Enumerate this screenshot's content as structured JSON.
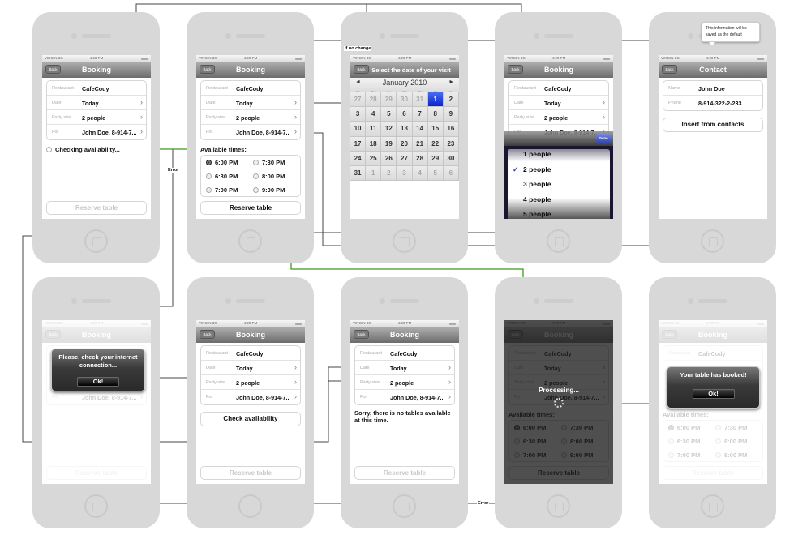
{
  "status": {
    "carrier": "VIRGIN  3G",
    "time": "4:20 PM"
  },
  "common": {
    "back": "Back",
    "chevron": "›"
  },
  "booking_rows": [
    {
      "label": "Restaurant",
      "value": "CafeCody",
      "chevron": false
    },
    {
      "label": "Date",
      "value": "Today",
      "chevron": true
    },
    {
      "label": "Party size",
      "value": "2 people",
      "chevron": true
    },
    {
      "label": "For",
      "value": "John Doe, 8-914-7...",
      "chevron": true
    }
  ],
  "times": {
    "label": "Available times:",
    "options": [
      "6:00 PM",
      "7:30 PM",
      "6:30 PM",
      "8:00 PM",
      "7:00 PM",
      "9:00 PM"
    ],
    "selected": "6:00 PM"
  },
  "screens": [
    {
      "id": "checking",
      "title": "Booking",
      "status_text": "Checking availability...",
      "reserve": "Reserve table",
      "reserve_enabled": false
    },
    {
      "id": "times",
      "title": "Booking",
      "reserve": "Reserve table",
      "reserve_enabled": true
    },
    {
      "id": "calendar",
      "title": "Select the date of your visit",
      "month": "January 2010",
      "prev": "◄",
      "next": "►",
      "day_names": [
        "Sun",
        "Mon",
        "Tue",
        "Wed",
        "Thu",
        "Fri",
        "Sat"
      ],
      "days": [
        "27",
        "28",
        "29",
        "30",
        "31",
        "1",
        "2",
        "3",
        "4",
        "5",
        "6",
        "7",
        "8",
        "9",
        "10",
        "11",
        "12",
        "13",
        "14",
        "15",
        "16",
        "17",
        "18",
        "19",
        "20",
        "21",
        "22",
        "23",
        "24",
        "25",
        "26",
        "27",
        "28",
        "29",
        "30",
        "31",
        "1",
        "2",
        "3",
        "4",
        "5",
        "6"
      ],
      "selected_day": "1"
    },
    {
      "id": "party-picker",
      "title": "Booking",
      "done": "Done",
      "options": [
        "1 people",
        "2 people",
        "3 people",
        "4 people",
        "5 people"
      ],
      "selected": "2 people",
      "check": "✓"
    },
    {
      "id": "contact",
      "title": "Contact",
      "rows": [
        {
          "label": "Name",
          "value": "John Doe"
        },
        {
          "label": "Phone",
          "value": "8-914-322-2-233"
        }
      ],
      "insert": "Insert from contacts",
      "tooltip": "This information will be saved as the default"
    },
    {
      "id": "connection-error",
      "title": "Booking",
      "alert": "Please, check your internet connection...",
      "ok": "Ok!",
      "reserve": "Reserve table"
    },
    {
      "id": "check-availability",
      "title": "Booking",
      "check": "Check availability",
      "reserve": "Reserve table"
    },
    {
      "id": "no-tables",
      "title": "Booking",
      "message": "Sorry, there is no tables available at this time.",
      "reserve": "Reserve table"
    },
    {
      "id": "processing",
      "title": "Booking",
      "processing": "Processing...",
      "reserve": "Reserve table"
    },
    {
      "id": "booked",
      "title": "Booking",
      "alert": "Your table has booked!",
      "ok": "Ok!",
      "reserve": "Reserve table"
    }
  ],
  "annotations": {
    "if_no_change": "If no change",
    "error_top": "Error",
    "error_bottom": "Error"
  },
  "colors": {
    "success_flow": "#3a9a1a",
    "flow": "#444444",
    "phone": "#d8d8d8",
    "calendar_selected": "#1030d8"
  }
}
